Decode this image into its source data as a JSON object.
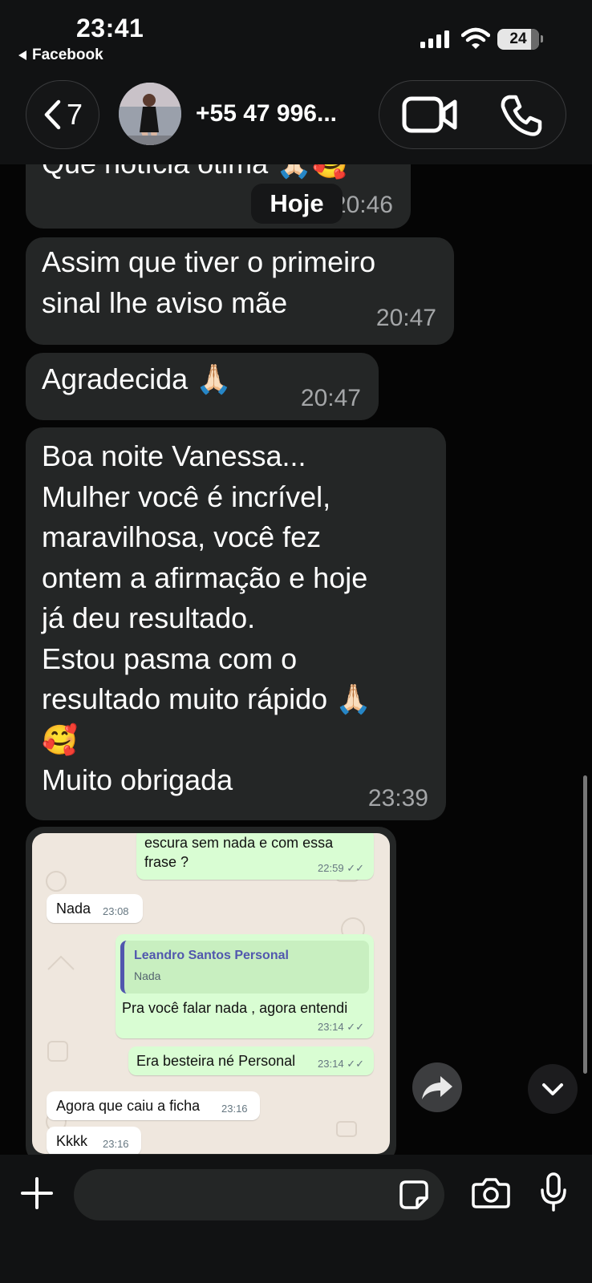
{
  "status_bar": {
    "time": "23:41",
    "back_app": "Facebook",
    "battery": "24"
  },
  "header": {
    "back_count": "7",
    "contact_name": "+55 47 996...",
    "video_icon": "video-camera-icon",
    "phone_icon": "phone-icon"
  },
  "date_chip": "Hoje",
  "messages": [
    {
      "text": "Que notícia ótima 🙏🏻🥰",
      "time": "20:46"
    },
    {
      "text": "Assim que tiver o primeiro\nsinal lhe aviso mãe",
      "time": "20:47"
    },
    {
      "text": "Agradecida 🙏🏻",
      "time": "20:47"
    },
    {
      "text": "Boa noite Vanessa...\nMulher você é incrível,\nmaravilhosa, você fez\nontem a afirmação e hoje\njá deu resultado.\nEstou pasma com o\nresultado muito rápido 🙏🏻\n🥰\nMuito obrigada",
      "time": "23:39"
    }
  ],
  "shared_screenshot": {
    "messages": [
      {
        "dir": "out",
        "text": "escura sem nada e com essa\nfrase ?",
        "time": "22:59"
      },
      {
        "dir": "in",
        "text": "Nada",
        "time": "23:08"
      },
      {
        "dir": "out",
        "quote_author": "Leandro Santos Personal",
        "quote_text": "Nada",
        "text": "Pra você falar nada , agora entendi",
        "time": "23:14"
      },
      {
        "dir": "out",
        "text": "Era besteira né Personal",
        "time": "23:14"
      },
      {
        "dir": "in",
        "text": "Agora que caiu a ficha",
        "time": "23:16"
      },
      {
        "dir": "in",
        "text": "Kkkk",
        "time": "23:16"
      }
    ]
  },
  "composer": {
    "placeholder": ""
  }
}
